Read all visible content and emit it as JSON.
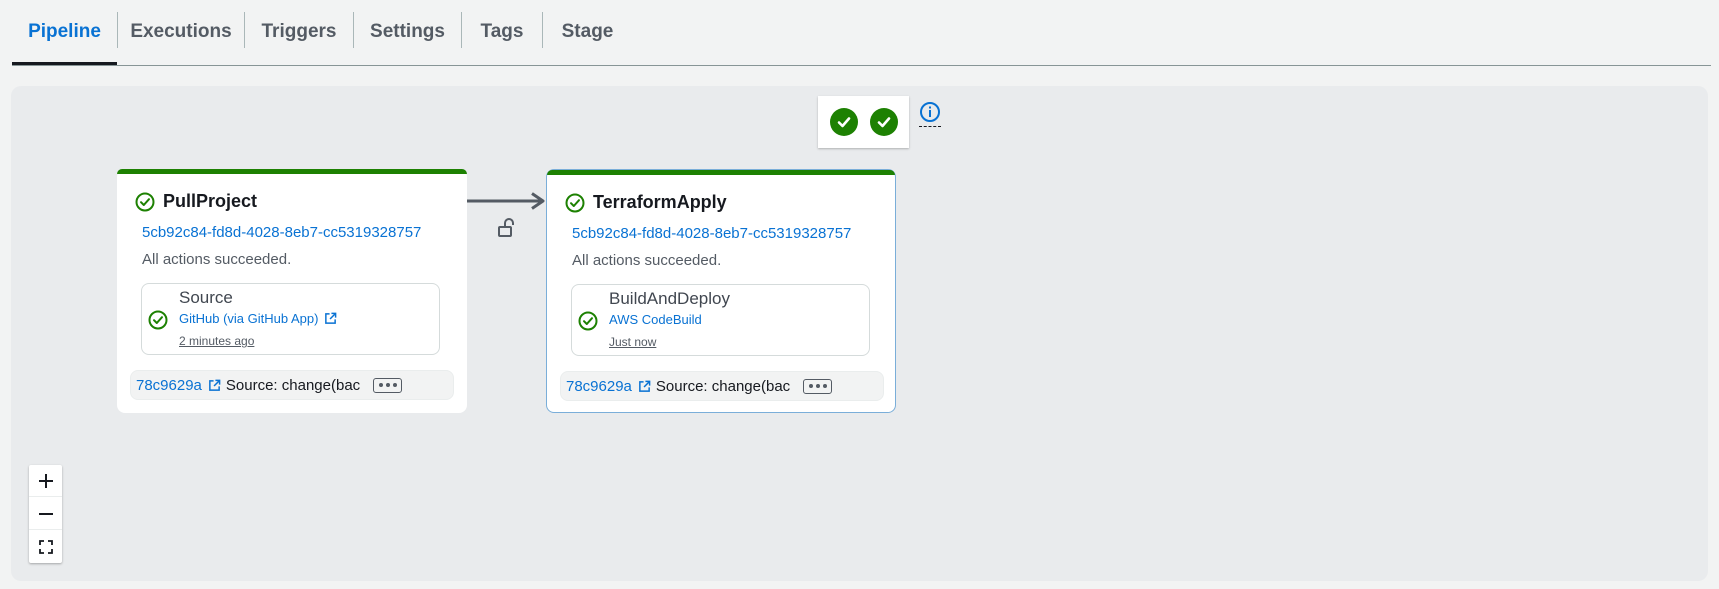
{
  "tabs": [
    {
      "label": "Pipeline",
      "active": true
    },
    {
      "label": "Executions",
      "active": false
    },
    {
      "label": "Triggers",
      "active": false
    },
    {
      "label": "Settings",
      "active": false
    },
    {
      "label": "Tags",
      "active": false
    },
    {
      "label": "Stage",
      "active": false
    }
  ],
  "colors": {
    "success": "#1d8102",
    "link": "#0972d3",
    "canvas": "#e9ebed",
    "selected_border": "#7aaed9"
  },
  "stages": [
    {
      "name": "PullProject",
      "execution_id": "5cb92c84-fd8d-4028-8eb7-cc5319328757",
      "message": "All actions succeeded.",
      "status_icon": "check-circle-icon",
      "action": {
        "name": "Source",
        "provider": "GitHub (via GitHub App)",
        "provider_icon": "external-link-icon",
        "time": "2 minutes ago"
      },
      "revision": {
        "id": "78c9629a",
        "message": "Source: change(bac"
      }
    },
    {
      "name": "TerraformApply",
      "execution_id": "5cb92c84-fd8d-4028-8eb7-cc5319328757",
      "message": "All actions succeeded.",
      "status_icon": "check-circle-icon",
      "action": {
        "name": "BuildAndDeploy",
        "provider": "AWS CodeBuild",
        "time": "Just now"
      },
      "revision": {
        "id": "78c9629a",
        "message": "Source: change(bac"
      }
    }
  ],
  "zoom_controls": [
    "zoom-in-icon",
    "zoom-out-icon",
    "fit-view-icon"
  ]
}
